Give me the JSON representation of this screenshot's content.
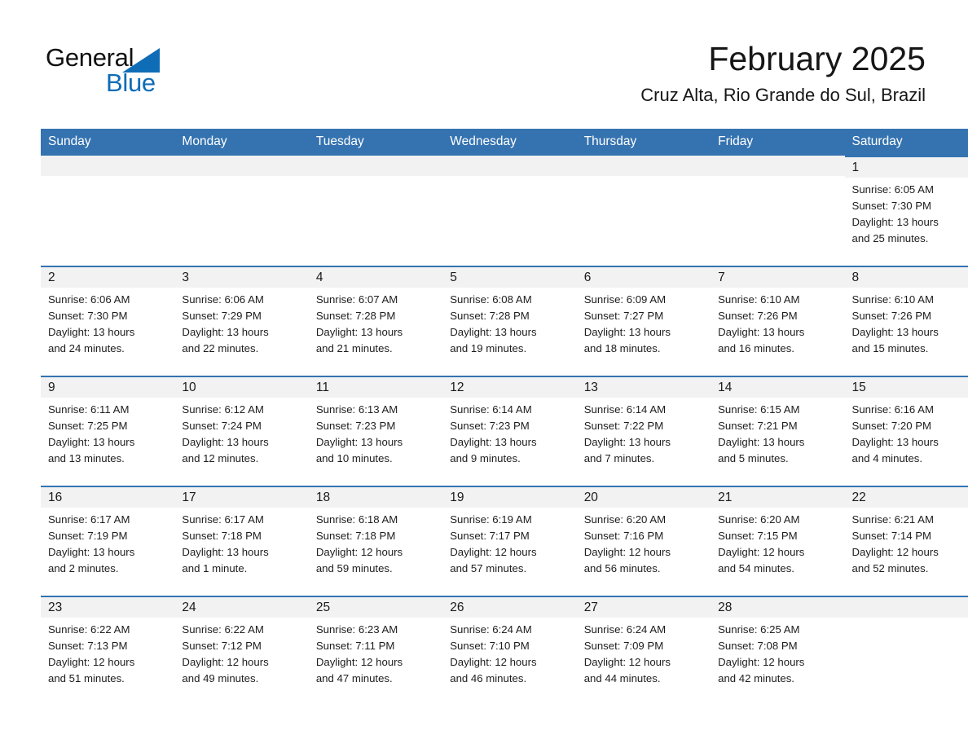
{
  "brand": {
    "name_part1": "General",
    "name_part2": "Blue",
    "triangle_icon": "triangle-icon"
  },
  "header": {
    "month_title": "February 2025",
    "location": "Cruz Alta, Rio Grande do Sul, Brazil"
  },
  "colors": {
    "header_blue": "#3573b0",
    "brand_blue": "#0f6cb6",
    "daynum_band": "#f2f2f2",
    "text": "#1a1a1a"
  },
  "weekdays": [
    "Sunday",
    "Monday",
    "Tuesday",
    "Wednesday",
    "Thursday",
    "Friday",
    "Saturday"
  ],
  "weeks": [
    [
      {
        "day": "",
        "lines": []
      },
      {
        "day": "",
        "lines": []
      },
      {
        "day": "",
        "lines": []
      },
      {
        "day": "",
        "lines": []
      },
      {
        "day": "",
        "lines": []
      },
      {
        "day": "",
        "lines": []
      },
      {
        "day": "1",
        "lines": [
          "Sunrise: 6:05 AM",
          "Sunset: 7:30 PM",
          "Daylight: 13 hours",
          "and 25 minutes."
        ]
      }
    ],
    [
      {
        "day": "2",
        "lines": [
          "Sunrise: 6:06 AM",
          "Sunset: 7:30 PM",
          "Daylight: 13 hours",
          "and 24 minutes."
        ]
      },
      {
        "day": "3",
        "lines": [
          "Sunrise: 6:06 AM",
          "Sunset: 7:29 PM",
          "Daylight: 13 hours",
          "and 22 minutes."
        ]
      },
      {
        "day": "4",
        "lines": [
          "Sunrise: 6:07 AM",
          "Sunset: 7:28 PM",
          "Daylight: 13 hours",
          "and 21 minutes."
        ]
      },
      {
        "day": "5",
        "lines": [
          "Sunrise: 6:08 AM",
          "Sunset: 7:28 PM",
          "Daylight: 13 hours",
          "and 19 minutes."
        ]
      },
      {
        "day": "6",
        "lines": [
          "Sunrise: 6:09 AM",
          "Sunset: 7:27 PM",
          "Daylight: 13 hours",
          "and 18 minutes."
        ]
      },
      {
        "day": "7",
        "lines": [
          "Sunrise: 6:10 AM",
          "Sunset: 7:26 PM",
          "Daylight: 13 hours",
          "and 16 minutes."
        ]
      },
      {
        "day": "8",
        "lines": [
          "Sunrise: 6:10 AM",
          "Sunset: 7:26 PM",
          "Daylight: 13 hours",
          "and 15 minutes."
        ]
      }
    ],
    [
      {
        "day": "9",
        "lines": [
          "Sunrise: 6:11 AM",
          "Sunset: 7:25 PM",
          "Daylight: 13 hours",
          "and 13 minutes."
        ]
      },
      {
        "day": "10",
        "lines": [
          "Sunrise: 6:12 AM",
          "Sunset: 7:24 PM",
          "Daylight: 13 hours",
          "and 12 minutes."
        ]
      },
      {
        "day": "11",
        "lines": [
          "Sunrise: 6:13 AM",
          "Sunset: 7:23 PM",
          "Daylight: 13 hours",
          "and 10 minutes."
        ]
      },
      {
        "day": "12",
        "lines": [
          "Sunrise: 6:14 AM",
          "Sunset: 7:23 PM",
          "Daylight: 13 hours",
          "and 9 minutes."
        ]
      },
      {
        "day": "13",
        "lines": [
          "Sunrise: 6:14 AM",
          "Sunset: 7:22 PM",
          "Daylight: 13 hours",
          "and 7 minutes."
        ]
      },
      {
        "day": "14",
        "lines": [
          "Sunrise: 6:15 AM",
          "Sunset: 7:21 PM",
          "Daylight: 13 hours",
          "and 5 minutes."
        ]
      },
      {
        "day": "15",
        "lines": [
          "Sunrise: 6:16 AM",
          "Sunset: 7:20 PM",
          "Daylight: 13 hours",
          "and 4 minutes."
        ]
      }
    ],
    [
      {
        "day": "16",
        "lines": [
          "Sunrise: 6:17 AM",
          "Sunset: 7:19 PM",
          "Daylight: 13 hours",
          "and 2 minutes."
        ]
      },
      {
        "day": "17",
        "lines": [
          "Sunrise: 6:17 AM",
          "Sunset: 7:18 PM",
          "Daylight: 13 hours",
          "and 1 minute."
        ]
      },
      {
        "day": "18",
        "lines": [
          "Sunrise: 6:18 AM",
          "Sunset: 7:18 PM",
          "Daylight: 12 hours",
          "and 59 minutes."
        ]
      },
      {
        "day": "19",
        "lines": [
          "Sunrise: 6:19 AM",
          "Sunset: 7:17 PM",
          "Daylight: 12 hours",
          "and 57 minutes."
        ]
      },
      {
        "day": "20",
        "lines": [
          "Sunrise: 6:20 AM",
          "Sunset: 7:16 PM",
          "Daylight: 12 hours",
          "and 56 minutes."
        ]
      },
      {
        "day": "21",
        "lines": [
          "Sunrise: 6:20 AM",
          "Sunset: 7:15 PM",
          "Daylight: 12 hours",
          "and 54 minutes."
        ]
      },
      {
        "day": "22",
        "lines": [
          "Sunrise: 6:21 AM",
          "Sunset: 7:14 PM",
          "Daylight: 12 hours",
          "and 52 minutes."
        ]
      }
    ],
    [
      {
        "day": "23",
        "lines": [
          "Sunrise: 6:22 AM",
          "Sunset: 7:13 PM",
          "Daylight: 12 hours",
          "and 51 minutes."
        ]
      },
      {
        "day": "24",
        "lines": [
          "Sunrise: 6:22 AM",
          "Sunset: 7:12 PM",
          "Daylight: 12 hours",
          "and 49 minutes."
        ]
      },
      {
        "day": "25",
        "lines": [
          "Sunrise: 6:23 AM",
          "Sunset: 7:11 PM",
          "Daylight: 12 hours",
          "and 47 minutes."
        ]
      },
      {
        "day": "26",
        "lines": [
          "Sunrise: 6:24 AM",
          "Sunset: 7:10 PM",
          "Daylight: 12 hours",
          "and 46 minutes."
        ]
      },
      {
        "day": "27",
        "lines": [
          "Sunrise: 6:24 AM",
          "Sunset: 7:09 PM",
          "Daylight: 12 hours",
          "and 44 minutes."
        ]
      },
      {
        "day": "28",
        "lines": [
          "Sunrise: 6:25 AM",
          "Sunset: 7:08 PM",
          "Daylight: 12 hours",
          "and 42 minutes."
        ]
      },
      {
        "day": "",
        "lines": []
      }
    ]
  ]
}
